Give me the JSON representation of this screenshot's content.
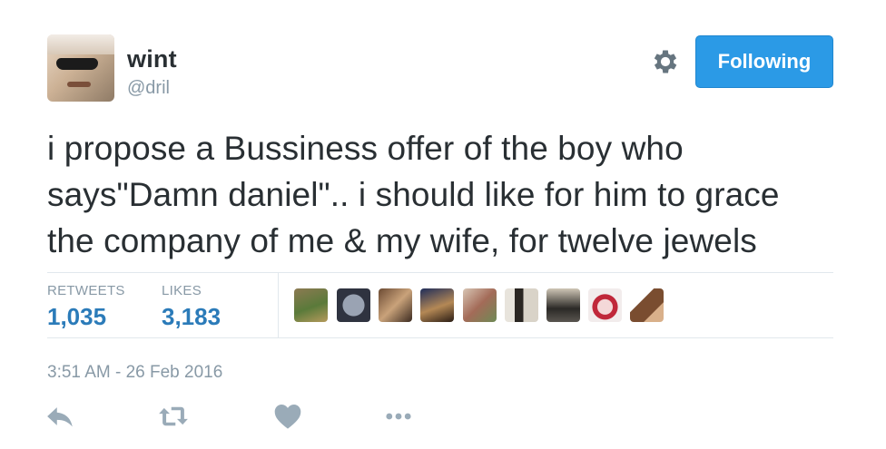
{
  "user": {
    "display_name": "wint",
    "handle": "@dril"
  },
  "header": {
    "settings_icon": "gear-icon",
    "follow_label": "Following",
    "follow_color": "#2b9ae6"
  },
  "tweet": {
    "line1": "i propose a Bussiness offer of the boy who",
    "line2": "says\"Damn daniel\".. i should like for him to grace",
    "line3": "the company of me & my wife, for twelve jewels"
  },
  "stats": {
    "retweets_label": "RETWEETS",
    "retweets_value": "1,035",
    "likes_label": "LIKES",
    "likes_value": "3,183",
    "value_color": "#2b7bb9"
  },
  "likers": [
    "avatar-1",
    "avatar-2",
    "avatar-3",
    "avatar-4",
    "avatar-5",
    "avatar-6",
    "avatar-7",
    "avatar-8",
    "avatar-9"
  ],
  "timestamp": "3:51 AM - 26 Feb 2016",
  "actions": [
    "reply-icon",
    "retweet-icon",
    "like-icon",
    "more-icon"
  ]
}
